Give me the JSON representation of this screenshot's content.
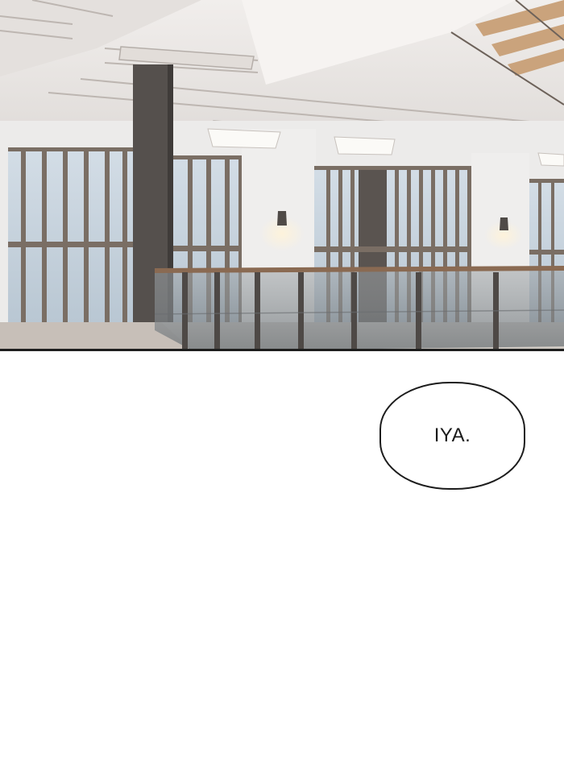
{
  "page": {
    "background": "#ffffff"
  },
  "illustration": {
    "scene": "illustration-interior-loft",
    "palette": {
      "ceiling": "#e9e6e4",
      "wall": "#ecebea",
      "column": "#55504d",
      "window_sky": "#c9d5df",
      "window_mullion": "#7a6e64",
      "railing_glass": "#a3a8ab",
      "railing_top": "#8a6a52",
      "floor": "#cfc9c3"
    }
  },
  "speech_bubble": {
    "text": "IYA."
  }
}
